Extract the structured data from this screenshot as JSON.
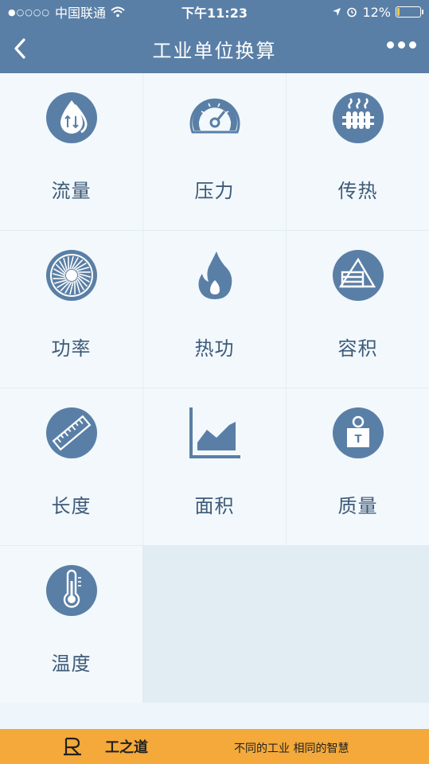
{
  "status_bar": {
    "carrier": "中国联通",
    "time": "下午11:23",
    "battery_percent": "12%",
    "battery_level": 0.12
  },
  "nav": {
    "title": "工业单位换算"
  },
  "categories": [
    {
      "label": "流量",
      "icon": "flow-drop-icon"
    },
    {
      "label": "压力",
      "icon": "pressure-gauge-icon"
    },
    {
      "label": "传热",
      "icon": "heat-transfer-icon"
    },
    {
      "label": "功率",
      "icon": "power-fan-icon"
    },
    {
      "label": "热功",
      "icon": "flame-icon"
    },
    {
      "label": "容积",
      "icon": "volume-icon"
    },
    {
      "label": "长度",
      "icon": "ruler-icon"
    },
    {
      "label": "面积",
      "icon": "area-chart-icon"
    },
    {
      "label": "质量",
      "icon": "weight-icon"
    },
    {
      "label": "温度",
      "icon": "thermometer-icon"
    }
  ],
  "footer": {
    "brand": "工之道",
    "slogan": "不同的工业 相同的智慧"
  },
  "colors": {
    "primary": "#5a7fa6",
    "icon": "#5a7fa6",
    "background": "#eef6fb",
    "footer": "#f4a93a"
  }
}
